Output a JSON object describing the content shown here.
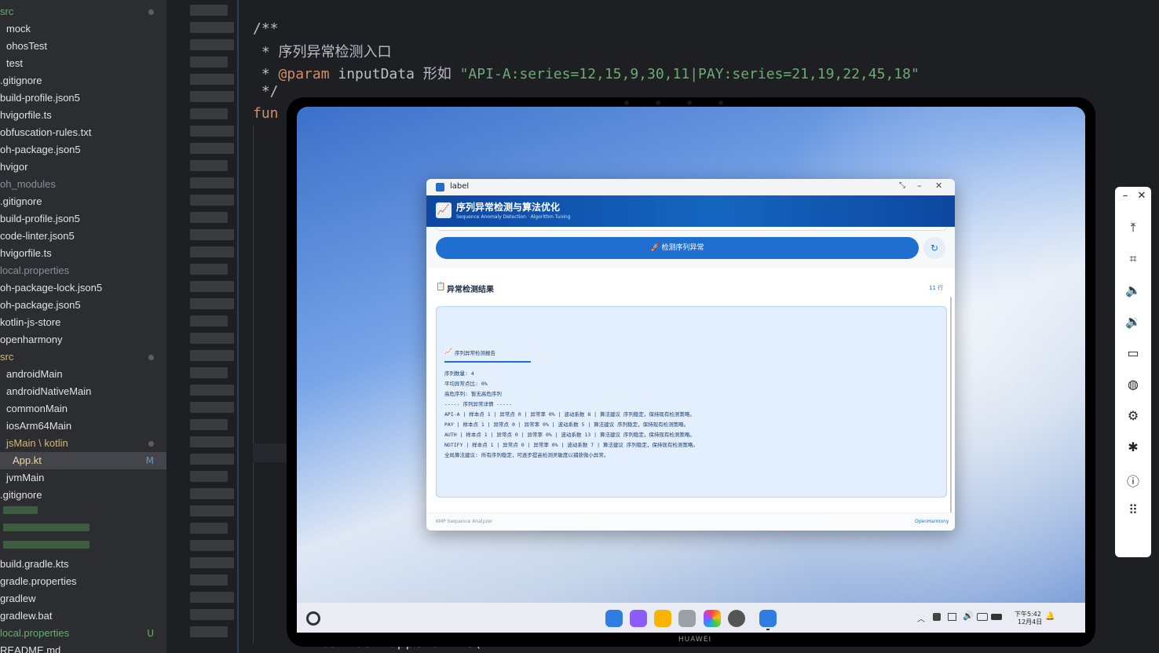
{
  "sidebar": {
    "items": [
      {
        "label": "src",
        "indent": 0
      },
      {
        "label": "mock",
        "indent": 1
      },
      {
        "label": "ohosTest",
        "indent": 1
      },
      {
        "label": "test",
        "indent": 1
      },
      {
        "label": ".gitignore",
        "indent": 0
      },
      {
        "label": "build-profile.json5",
        "indent": 0
      },
      {
        "label": "hvigorfile.ts",
        "indent": 0
      },
      {
        "label": "obfuscation-rules.txt",
        "indent": 0
      },
      {
        "label": "oh-package.json5",
        "indent": 0
      },
      {
        "label": "hvigor",
        "indent": 0
      },
      {
        "label": "oh_modules",
        "indent": 0
      },
      {
        "label": ".gitignore",
        "indent": 0
      },
      {
        "label": "build-profile.json5",
        "indent": 0
      },
      {
        "label": "code-linter.json5",
        "indent": 0
      },
      {
        "label": "hvigorfile.ts",
        "indent": 0
      },
      {
        "label": "local.properties",
        "indent": 0
      },
      {
        "label": "oh-package-lock.json5",
        "indent": 0
      },
      {
        "label": "oh-package.json5",
        "indent": 0
      },
      {
        "label": "kotlin-js-store",
        "indent": 0
      },
      {
        "label": "openharmony",
        "indent": 0
      },
      {
        "label": "src",
        "indent": 0
      },
      {
        "label": "androidMain",
        "indent": 1
      },
      {
        "label": "androidNativeMain",
        "indent": 1
      },
      {
        "label": "commonMain",
        "indent": 1
      },
      {
        "label": "iosArm64Main",
        "indent": 1
      },
      {
        "label": "jsMain \\ kotlin",
        "indent": 1
      },
      {
        "label": "App.kt",
        "indent": 1,
        "badge": "M"
      },
      {
        "label": "jvmMain",
        "indent": 1
      },
      {
        "label": ".gitignore",
        "indent": 0
      },
      {
        "label": "build.gradle.kts",
        "indent": 0
      },
      {
        "label": "gradle.properties",
        "indent": 0
      },
      {
        "label": "gradlew",
        "indent": 0
      },
      {
        "label": "gradlew.bat",
        "indent": 0
      },
      {
        "label": "local.properties",
        "indent": 0,
        "badge": "U"
      },
      {
        "label": "README.md",
        "indent": 0
      }
    ],
    "badge_m": "M",
    "badge_u": "U"
  },
  "editor": {
    "line1": "/**",
    "line2": " * 序列异常检测入口",
    "line3_prefix": " * ",
    "line3_kw": "@param",
    "line3_rest": " inputData 形如 ",
    "line3_str": "\"API-A:series=12,15,9,30,11|PAY:series=21,19,22,45,18\"",
    "line4": " */",
    "line5": "fun",
    "bottom_line": "builder.appendLine("
  },
  "app": {
    "window_title": "label",
    "header_title": "序列异常检测与算法优化",
    "header_subtitle": "Sequence Anomaly Detection · Algorithm Tuning",
    "detect_button": "🚀 检测序列异常",
    "refresh_icon": "↻",
    "result_title": "异常检测结果",
    "result_count": "11 行",
    "report_title": "序列异常检测报告",
    "report_lines": [
      "序列数量: 4",
      "平均异常点比: 0%",
      "高危序列: 暂无高危序列",
      "----- 序列异常详情 -----",
      "API-A | 样本点 1 | 异常点 0 | 异常率 0% | 波动系数 8 | 算法建议 序列稳定，保持现有检测策略。",
      "PAY | 样本点 1 | 异常点 0 | 异常率 0% | 波动系数 5 | 算法建议 序列稳定，保持现有检测策略。",
      "AUTH | 样本点 1 | 异常点 0 | 异常率 0% | 波动系数 13 | 算法建议 序列稳定，保持现有检测策略。",
      "NOTIFY | 样本点 1 | 异常点 0 | 异常率 0% | 波动系数 7 | 算法建议 序列稳定，保持现有检测策略。",
      "全局算法建议: 所有序列稳定，可逐步提高检测灵敏度以捕获微小异常。"
    ],
    "footer_left": "KMP Sequence Analyzer",
    "footer_right": "OpenHarmony"
  },
  "taskbar": {
    "time": "下午5:42",
    "date": "12月4日"
  },
  "device": {
    "brand": "HUAWEI"
  },
  "colors": {
    "accent": "#1e6fd0",
    "header": "#0d47a1"
  }
}
